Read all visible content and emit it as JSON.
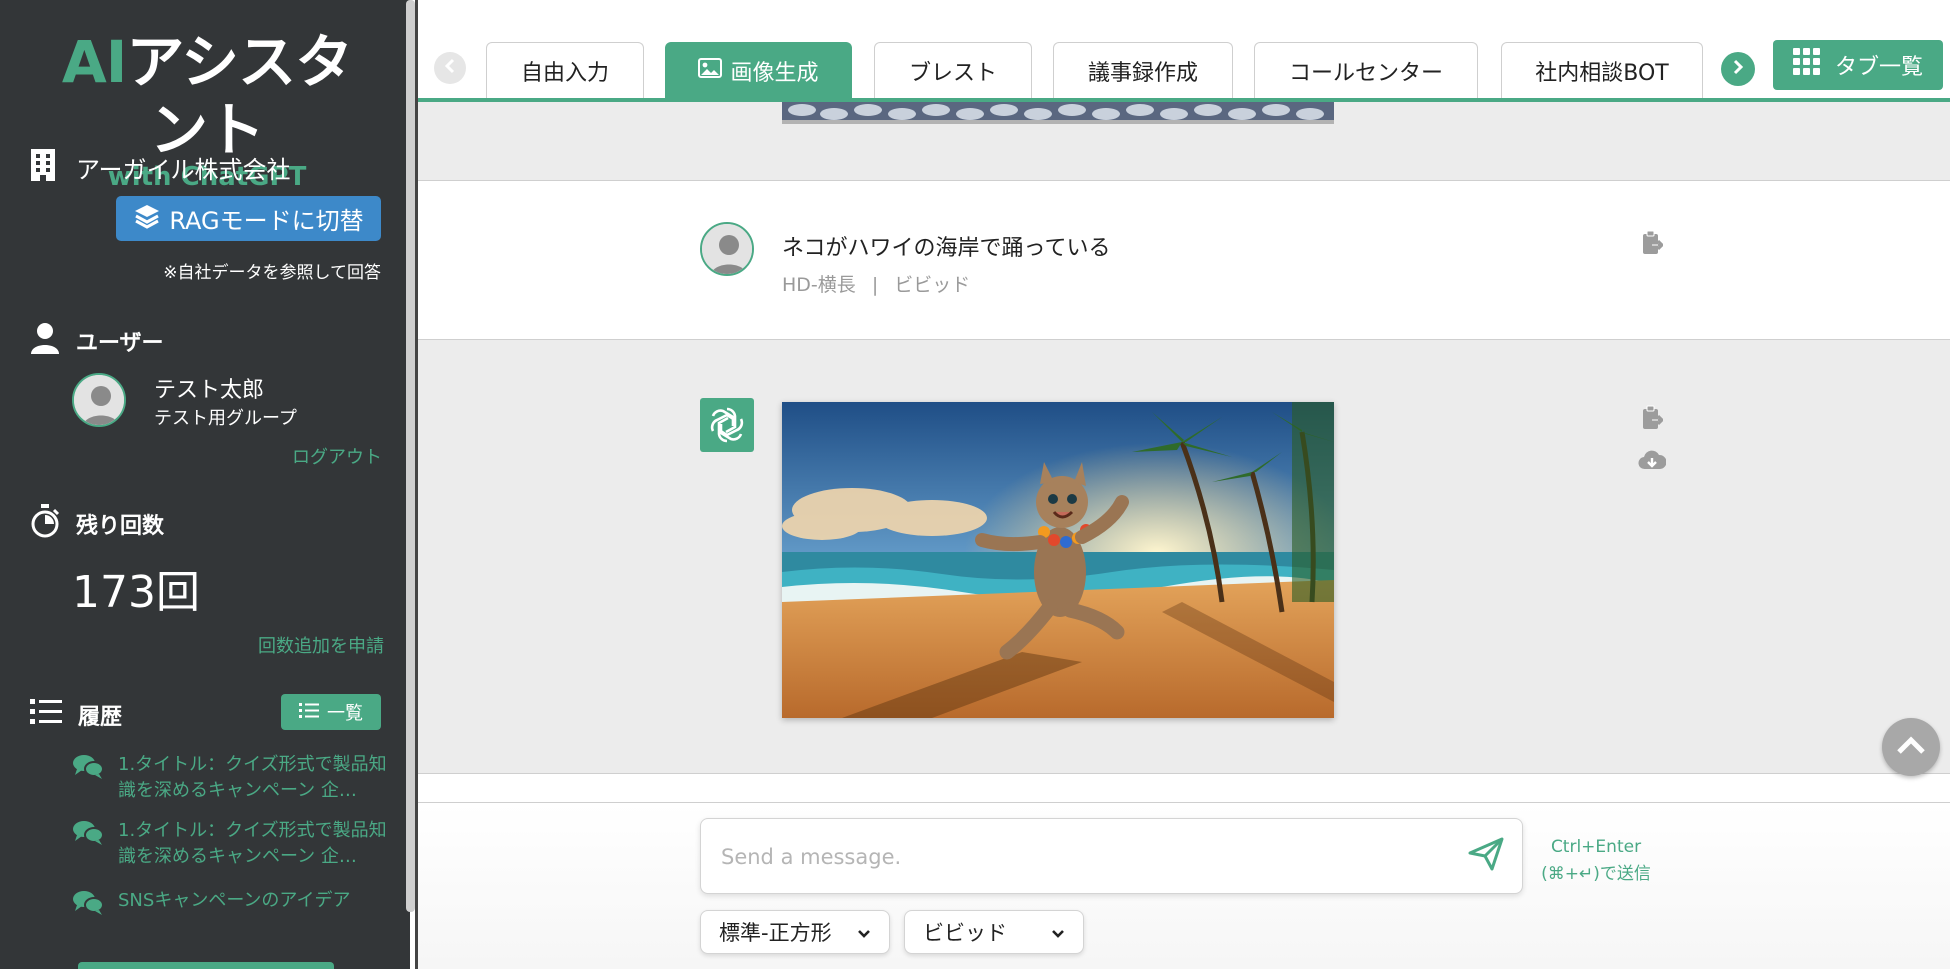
{
  "logo": {
    "ai": "AI",
    "rest": "アシスタント",
    "sub": "with ChatGPT"
  },
  "company": {
    "name": "アーガイル株式会社",
    "rag_button": "RAGモードに切替",
    "rag_note": "※自社データを参照して回答"
  },
  "user": {
    "section": "ユーザー",
    "name": "テスト太郎",
    "group": "テスト用グループ",
    "logout": "ログアウト"
  },
  "remaining": {
    "section": "残り回数",
    "count": "173回",
    "request_link": "回数追加を申請"
  },
  "history": {
    "section": "履歴",
    "list_button": "一覧",
    "items": [
      {
        "label": "1.タイトル：クイズ形式で製品知識を深めるキャンペーン 企…"
      },
      {
        "label": "1.タイトル：クイズ形式で製品知識を深めるキャンペーン 企…"
      },
      {
        "label": "SNSキャンペーンのアイデア"
      }
    ]
  },
  "tabs": {
    "items": [
      {
        "label": "自由入力"
      },
      {
        "label": "画像生成"
      },
      {
        "label": "ブレスト"
      },
      {
        "label": "議事録作成"
      },
      {
        "label": "コールセンター"
      },
      {
        "label": "社内相談BOT"
      }
    ],
    "active_index": 1,
    "list_button": "タブ一覧"
  },
  "conversation": {
    "user_message": "ネコがハワイの海岸で踊っている",
    "meta_size": "HD-横長",
    "meta_separator": "|",
    "meta_style": "ビビッド"
  },
  "composer": {
    "placeholder": "Send a message.",
    "hint_line1": "Ctrl+Enter",
    "hint_line2": "(⌘+↵)で送信",
    "size_select": "標準-正方形",
    "style_select": "ビビッド"
  },
  "colors": {
    "accent": "#4aa985",
    "sidebar": "#333638",
    "rag": "#3d89c9",
    "gray_block": "#ececec"
  },
  "icons": [
    "building-icon",
    "layers-icon",
    "user-icon",
    "stopwatch-icon",
    "list-icon",
    "chat-bubbles-icon",
    "image-icon",
    "grid-icon",
    "clipboard-icon",
    "cloud-download-icon",
    "openai-icon",
    "send-icon",
    "chevron-up-icon",
    "chevron-down-icon",
    "chevron-left-icon",
    "chevron-right-icon"
  ]
}
